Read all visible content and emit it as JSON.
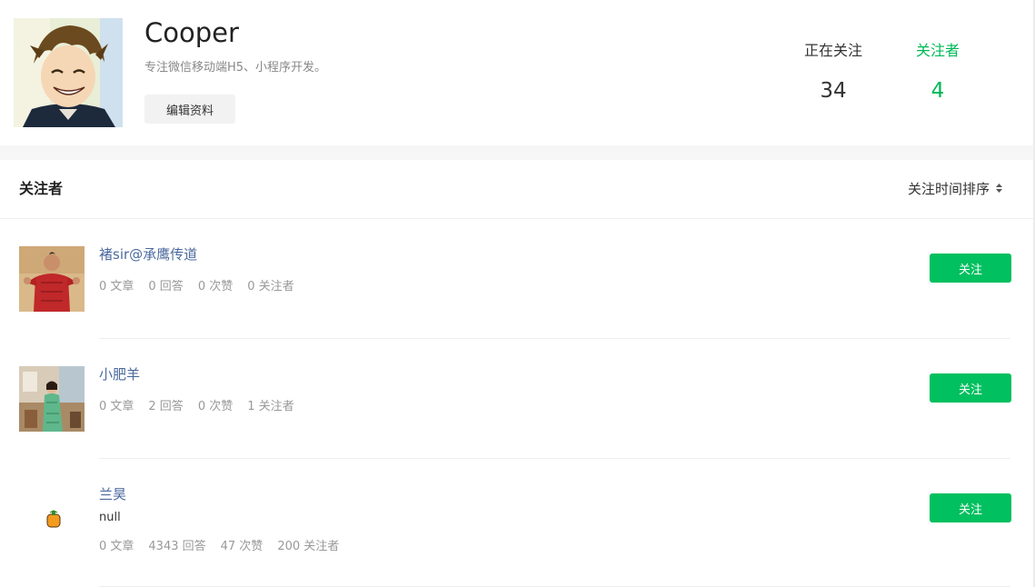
{
  "profile": {
    "name": "Cooper",
    "bio": "专注微信移动端H5、小程序开发。",
    "edit_label": "编辑资料",
    "following_label": "正在关注",
    "following_count": "34",
    "followers_label": "关注者",
    "followers_count": "4"
  },
  "colors": {
    "accent": "#00c05f",
    "link": "#4b6a9e",
    "muted": "#999999"
  },
  "list": {
    "title": "关注者",
    "sort_label": "关注时间排序",
    "follow_label": "关注",
    "users": [
      {
        "name": "褚sir@承鹰传道",
        "articles": "0 文章",
        "answers": "0 回答",
        "likes": "0 次赞",
        "followers": "0 关注者"
      },
      {
        "name": "小肥羊",
        "articles": "0 文章",
        "answers": "2 回答",
        "likes": "0 次赞",
        "followers": "1 关注者"
      },
      {
        "name": "兰昊",
        "bio": "null",
        "articles": "0 文章",
        "answers": "4343 回答",
        "likes": "47 次赞",
        "followers": "200 关注者"
      }
    ]
  }
}
